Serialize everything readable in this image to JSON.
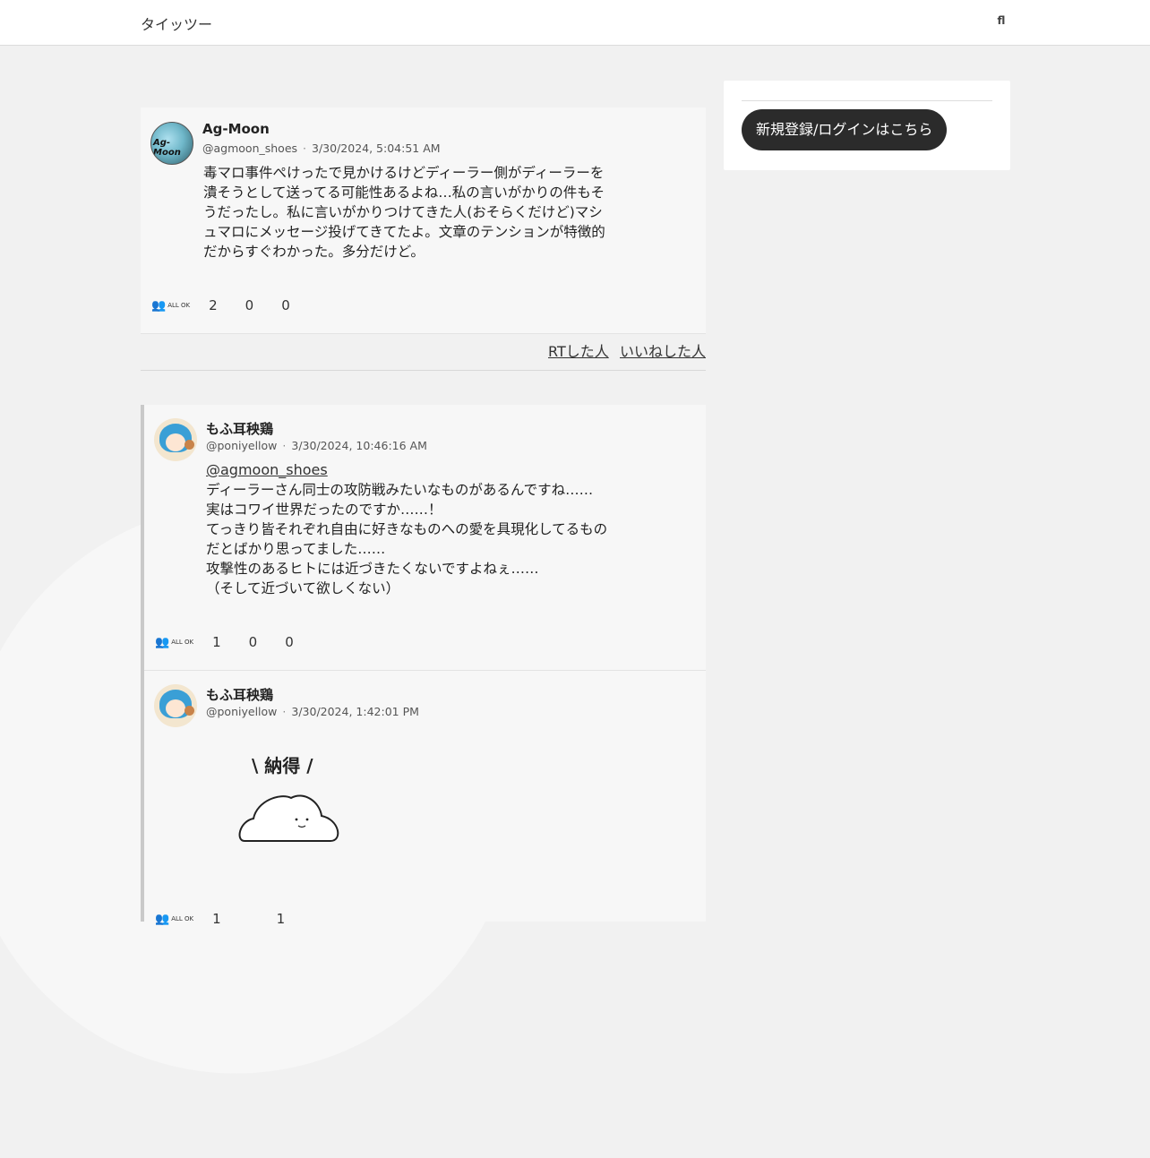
{
  "header": {
    "brand": "タイッツー",
    "icons": [
      "",
      "",
      "",
      "fl"
    ],
    "icon_names": [
      "home-icon",
      "bell-icon",
      "user-icon",
      "search-icon"
    ]
  },
  "posts": [
    {
      "display_name": "Ag-Moon",
      "badge": "",
      "handle": "@agmoon_shoes",
      "timestamp": "3/30/2024, 5:04:51 AM",
      "lines": [
        "毒マロ事件ぺけったで見かけるけどディーラー側がディーラーを",
        "潰そうとして送ってる可能性あるよね…私の言いがかりの件もそ",
        "うだったし。私に言いがかりつけてきた人(おそらくだけど)マシ",
        "ュマロにメッセージ投げてきてたよ。文章のテンションが特徴的",
        "だからすぐわかった。多分だけど。"
      ],
      "audience": "ALL OK",
      "reply_icon": "",
      "reply_count": "2",
      "rt_icon": "",
      "rt_count": "0",
      "like_icon": "",
      "like_count": "0",
      "footer_links": [
        "RTした人",
        "いいねした人"
      ]
    },
    {
      "display_name": "もふ耳秧鶏",
      "name_prefix": "",
      "name_suffix": "",
      "badge": "",
      "handle": "@poniyellow",
      "timestamp": "3/30/2024, 10:46:16 AM",
      "mention": "@agmoon_shoes",
      "lines": [
        "ディーラーさん同士の攻防戦みたいなものがあるんですね……",
        "実はコワイ世界だったのですか……！",
        "てっきり皆それぞれ自由に好きなものへの愛を具現化してるもの",
        "だとばかり思ってました……",
        "攻撃性のあるヒトには近づきたくないですよねぇ……",
        "（そして近づいて欲しくない）"
      ],
      "audience": "ALL OK",
      "reply_icon": "",
      "reply_count": "1",
      "rt_icon": "",
      "rt_count": "0",
      "like_icon": "",
      "like_count": "0"
    },
    {
      "display_name": "もふ耳秧鶏",
      "name_prefix": "",
      "name_suffix": "",
      "badge": "",
      "handle": "@poniyellow",
      "timestamp": "3/30/2024, 1:42:01 PM",
      "sticker_text": "\\ 納得 /",
      "audience": "ALL OK",
      "reply_icon": "",
      "reply_count": "1",
      "rt_icon": "",
      "rt_count": "",
      "like_icon": "",
      "like_count": "1"
    }
  ],
  "sidebar": {
    "login_button": "新規登録/ログインはこちら"
  }
}
